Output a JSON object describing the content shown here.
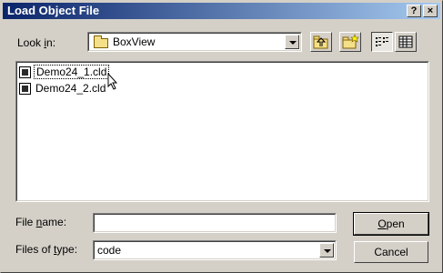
{
  "window": {
    "title": "Load Object File",
    "help_glyph": "?",
    "close_glyph": "×"
  },
  "look_in": {
    "label_pre": "Look ",
    "label_mnemonic": "i",
    "label_post": "n:",
    "value": "BoxView"
  },
  "toolbar": {
    "up_one_level": "up-folder-icon",
    "new_folder": "new-folder-icon",
    "list_view": "list-view-icon",
    "details_view": "details-view-icon"
  },
  "files": [
    {
      "name": "Demo24_1.cld",
      "focused": true
    },
    {
      "name": "Demo24_2.cld",
      "focused": false
    }
  ],
  "file_name": {
    "label_pre": "File ",
    "label_mnemonic": "n",
    "label_post": "ame:",
    "value": ""
  },
  "file_type": {
    "label_pre": "Files of ",
    "label_mnemonic": "t",
    "label_post": "ype:",
    "value": "code"
  },
  "buttons": {
    "open_mnemonic": "O",
    "open_rest": "pen",
    "cancel": "Cancel"
  },
  "colors": {
    "title_start": "#0a246a",
    "title_end": "#a6caf0",
    "face": "#d4d0c8"
  }
}
